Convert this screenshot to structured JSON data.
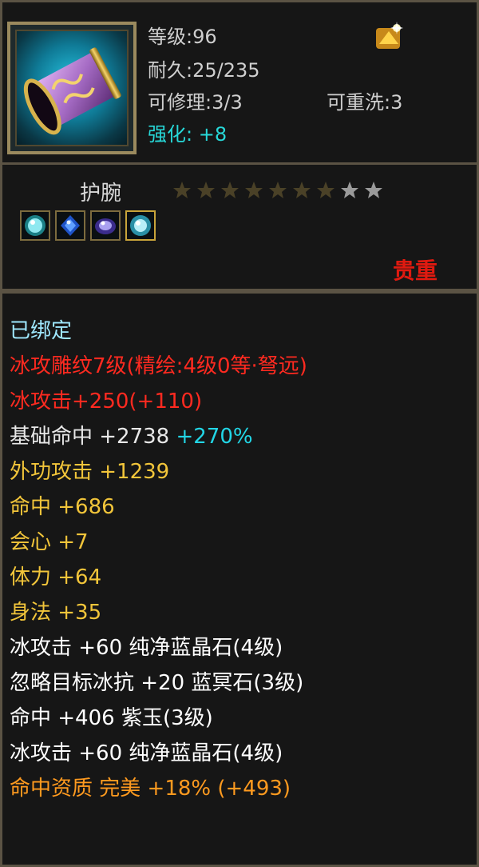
{
  "item": {
    "level": "等级:96",
    "durability": "耐久:25/235",
    "repair": "可修理:3/3",
    "reroll": "可重洗:3",
    "enhance": "强化: +8",
    "name": "护腕",
    "stars_filled": 7,
    "stars_total": 9,
    "precious": "贵重",
    "icon": "bracer-icon"
  },
  "gems": [
    "gem-cyan-icon",
    "gem-blue-icon",
    "gem-purple-icon",
    "gem-teal-icon"
  ],
  "stats": {
    "bound": "已绑定",
    "engrave": "冰攻雕纹7级(精绘:4级0等·弩远)",
    "ice_attack_main": "冰攻击+250(+110)",
    "base_hit_label": "基础命中 +2738",
    "base_hit_pct": "+270%",
    "outer_attack": "外功攻击 +1239",
    "hit": "命中 +686",
    "crit": "会心 +7",
    "stamina": "体力 +64",
    "agility": "身法 +35",
    "gem1": "冰攻击 +60 纯净蓝晶石(4级)",
    "gem2": "忽略目标冰抗 +20 蓝冥石(3级)",
    "gem3": "命中 +406 紫玉(3级)",
    "gem4": "冰攻击 +60 纯净蓝晶石(4级)",
    "aptitude": "命中资质  完美 +18% (+493)"
  },
  "colors": {
    "bound": "#9fe8ff",
    "engrave": "#ff2a20",
    "base": "#e8e8e8",
    "bonus": "#f2c53a",
    "enhance": "#27d8d8",
    "aptitude": "#ff9a1f",
    "precious": "#e01a10"
  }
}
